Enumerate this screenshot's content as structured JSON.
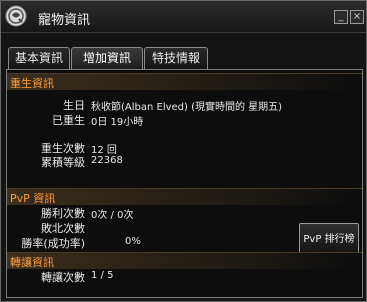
{
  "window": {
    "title": "寵物資訊",
    "minimize_label": "_",
    "close_label": "×"
  },
  "tabs": [
    {
      "label": "基本資訊"
    },
    {
      "label": "增加資訊"
    },
    {
      "label": "特技情報"
    }
  ],
  "active_tab_index": 1,
  "rebirth": {
    "header": "重生資訊",
    "birthday_label": "生日",
    "birthday_value": "秋收節(Alban Elved) (現實時間的 星期五)",
    "rebirth_elapsed_label": "已重生",
    "rebirth_elapsed_value": "0日 19小時",
    "rebirth_count_label": "重生次數",
    "rebirth_count_value": "12 回",
    "cumulative_level_label": "累積等級",
    "cumulative_level_value": "22368"
  },
  "pvp": {
    "header": "PvP 資訊",
    "wins_label": "勝利次數",
    "wins_value": "0次 / 0次",
    "losses_label": "敗北次數",
    "win_rate_label": "勝率(成功率)",
    "win_rate_value": "0%",
    "ranking_button_label": "PvP 排行榜"
  },
  "transfer": {
    "header": "轉讓資訊",
    "transfer_count_label": "轉讓次數",
    "transfer_count_value": "1 / 5"
  },
  "colors": {
    "section_header_text": "#ff9e3d",
    "panel_background": "#0d0d0d"
  }
}
